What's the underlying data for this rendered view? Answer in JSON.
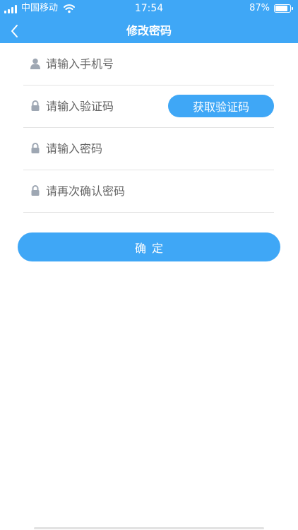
{
  "status_bar": {
    "carrier": "中国移动",
    "time": "17:54",
    "battery_percent": "87%",
    "battery_level": 0.87
  },
  "nav": {
    "title": "修改密码",
    "back_icon": "chevron-left-icon"
  },
  "form": {
    "phone_placeholder": "请输入手机号",
    "code_placeholder": "请输入验证码",
    "get_code_label": "获取验证码",
    "password_placeholder": "请输入密码",
    "confirm_password_placeholder": "请再次确认密码"
  },
  "confirm_label": "确定",
  "colors": {
    "primary": "#3fa7f6",
    "icon": "#9ea7b3",
    "divider": "#e3e3e3"
  }
}
